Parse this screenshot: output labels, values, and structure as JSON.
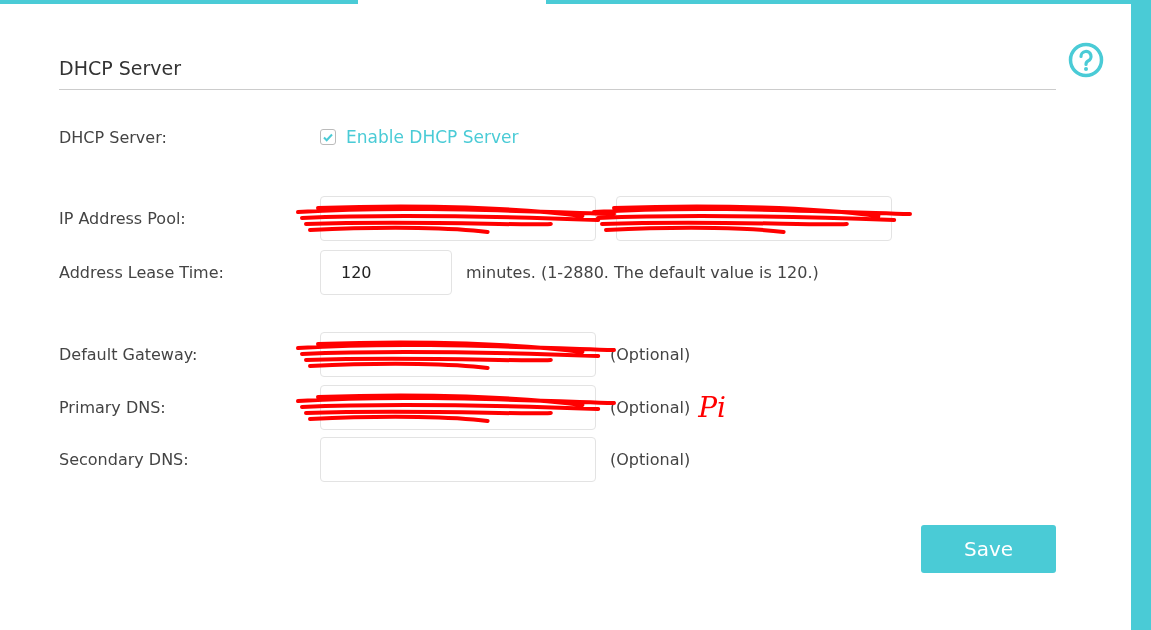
{
  "section": {
    "title": "DHCP Server"
  },
  "rows": [
    {
      "kind": "checkbox",
      "label": "DHCP Server:",
      "option": "Enable DHCP Server",
      "checked": true
    },
    {
      "kind": "range",
      "label": "IP Address Pool:",
      "fields": [
        {
          "redacted": true
        },
        {
          "redacted": true
        }
      ]
    },
    {
      "kind": "number",
      "label": "Address Lease Time:",
      "fields": [
        {
          "value": "120",
          "redacted": false
        }
      ],
      "hint": "minutes. (1-2880. The default value is 120.)"
    },
    {
      "kind": "text",
      "label": "Default Gateway:",
      "fields": [
        {
          "redacted": true
        }
      ],
      "hint": "(Optional)"
    },
    {
      "kind": "text",
      "label": "Primary DNS:",
      "fields": [
        {
          "redacted": true
        }
      ],
      "hint": "(Optional)",
      "annotation": "Pi"
    },
    {
      "kind": "text",
      "label": "Secondary DNS:",
      "fields": [
        {
          "redacted": false
        }
      ],
      "hint": "(Optional)"
    }
  ],
  "buttons": [
    {
      "label": "Save"
    }
  ]
}
